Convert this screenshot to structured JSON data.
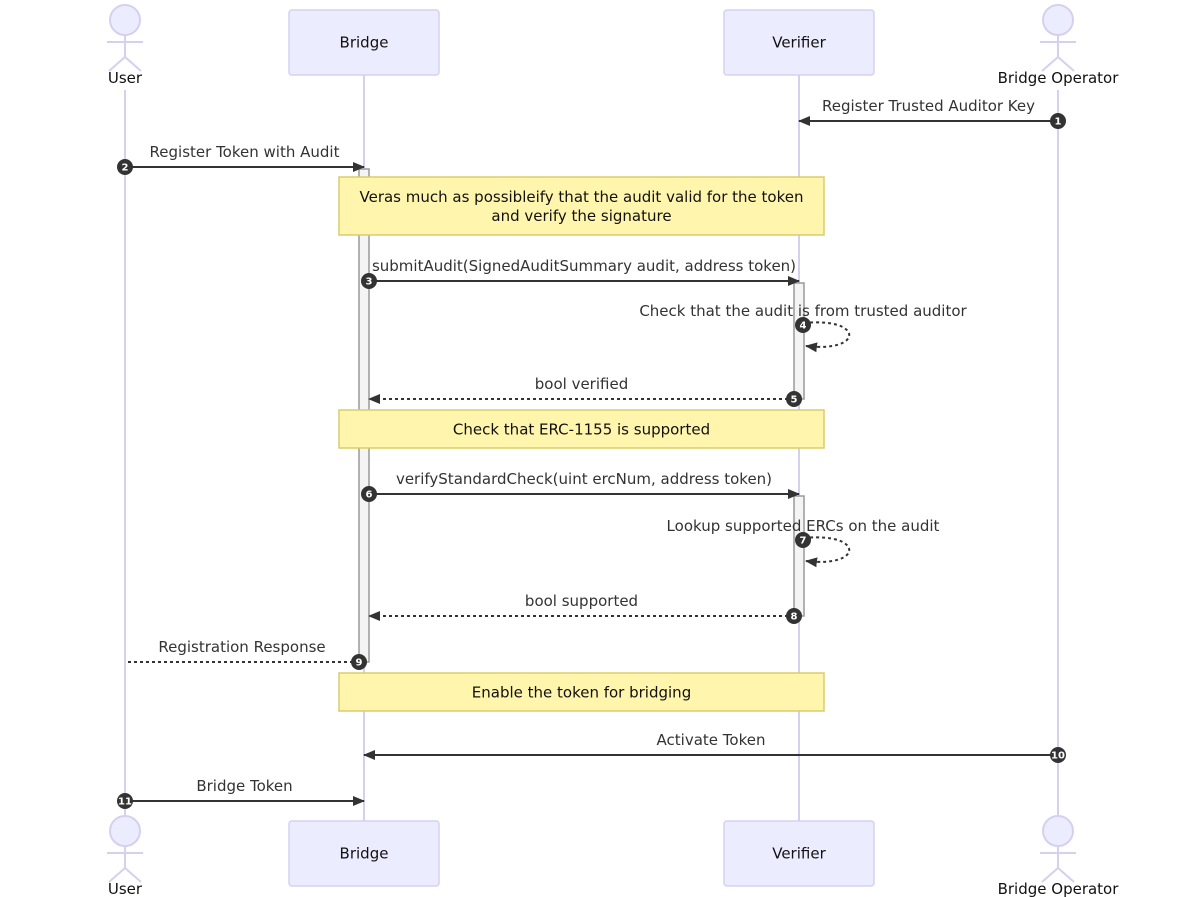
{
  "diagram": {
    "type": "sequence",
    "colors": {
      "actor_fill": "#ececff",
      "actor_stroke": "#d6d0f0",
      "note_fill": "#fff5ad",
      "arrow": "#333333"
    },
    "participants": [
      {
        "id": "user",
        "label": "User",
        "kind": "actor"
      },
      {
        "id": "bridge",
        "label": "Bridge",
        "kind": "participant"
      },
      {
        "id": "verifier",
        "label": "Verifier",
        "kind": "participant"
      },
      {
        "id": "operator",
        "label": "Bridge Operator",
        "kind": "actor"
      }
    ],
    "steps": [
      {
        "kind": "message",
        "num": "1",
        "from": "operator",
        "to": "verifier",
        "text": "Register Trusted Auditor Key",
        "style": "solid"
      },
      {
        "kind": "message",
        "num": "2",
        "from": "user",
        "to": "bridge",
        "text": "Register Token with Audit",
        "style": "solid",
        "activate": "bridge"
      },
      {
        "kind": "note",
        "over": [
          "bridge",
          "verifier"
        ],
        "lines": [
          "Veras much as possibleify that the audit valid for the token",
          "and verify the signature"
        ]
      },
      {
        "kind": "message",
        "num": "3",
        "from": "bridge",
        "to": "verifier",
        "text": "submitAudit(SignedAuditSummary audit, address token)",
        "style": "solid",
        "activate": "verifier"
      },
      {
        "kind": "self",
        "num": "4",
        "on": "verifier",
        "text": "Check that the audit is from trusted auditor",
        "style": "dashed"
      },
      {
        "kind": "message",
        "num": "5",
        "from": "verifier",
        "to": "bridge",
        "text": "bool verified",
        "style": "dashed",
        "deactivate": "verifier"
      },
      {
        "kind": "note",
        "over": [
          "bridge",
          "verifier"
        ],
        "lines": [
          "Check that ERC-1155 is supported"
        ]
      },
      {
        "kind": "message",
        "num": "6",
        "from": "bridge",
        "to": "verifier",
        "text": "verifyStandardCheck(uint ercNum, address token)",
        "style": "solid",
        "activate": "verifier"
      },
      {
        "kind": "self",
        "num": "7",
        "on": "verifier",
        "text": "Lookup supported ERCs on the audit",
        "style": "dashed"
      },
      {
        "kind": "message",
        "num": "8",
        "from": "verifier",
        "to": "bridge",
        "text": "bool supported",
        "style": "dashed",
        "deactivate": "verifier"
      },
      {
        "kind": "message",
        "num": "9",
        "from": "bridge",
        "to": "user",
        "text": "Registration Response",
        "style": "dashed",
        "deactivate": "bridge"
      },
      {
        "kind": "note",
        "over": [
          "bridge",
          "verifier"
        ],
        "lines": [
          "Enable the token for bridging"
        ]
      },
      {
        "kind": "message",
        "num": "10",
        "from": "operator",
        "to": "bridge",
        "text": "Activate Token",
        "style": "solid"
      },
      {
        "kind": "message",
        "num": "11",
        "from": "user",
        "to": "bridge",
        "text": "Bridge Token",
        "style": "solid"
      }
    ]
  }
}
